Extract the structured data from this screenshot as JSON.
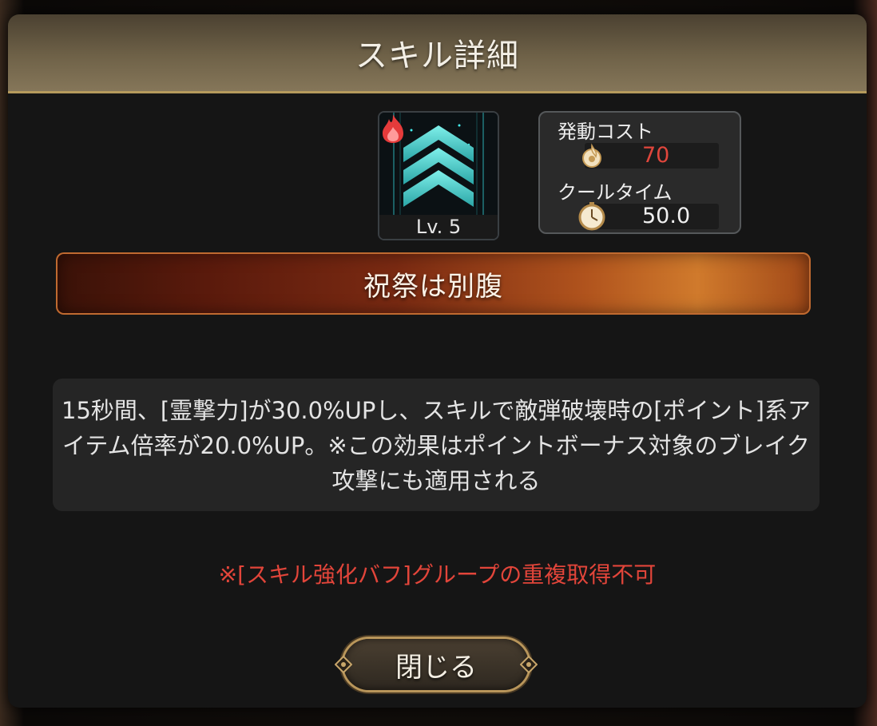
{
  "dialog": {
    "title": "スキル詳細",
    "close_label": "閉じる"
  },
  "skill": {
    "icon_name": "chevron-up-rank-icon",
    "badge_icon": "fire-icon",
    "level_label": "Lv. 5",
    "name": "祝祭は別腹",
    "description": "15秒間、[霊撃力]が30.0%UPし、スキルで敵弾破壊時の[ポイント]系アイテム倍率が20.0%UP。※この効果はポイントボーナス対象のブレイク攻撃にも適用される",
    "warning": "※[スキル強化バフ]グループの重複取得不可"
  },
  "stats": {
    "cost_label": "発動コスト",
    "cost_value": "70",
    "cost_icon": "spirit-flame-icon",
    "cooldown_label": "クールタイム",
    "cooldown_value": "50.0",
    "cooldown_icon": "clock-icon"
  },
  "colors": {
    "cost_value": "#e0463c",
    "cooldown_value": "#f0f0f0",
    "warning": "#e2453a",
    "icon_accent": "#3fd3d0"
  }
}
